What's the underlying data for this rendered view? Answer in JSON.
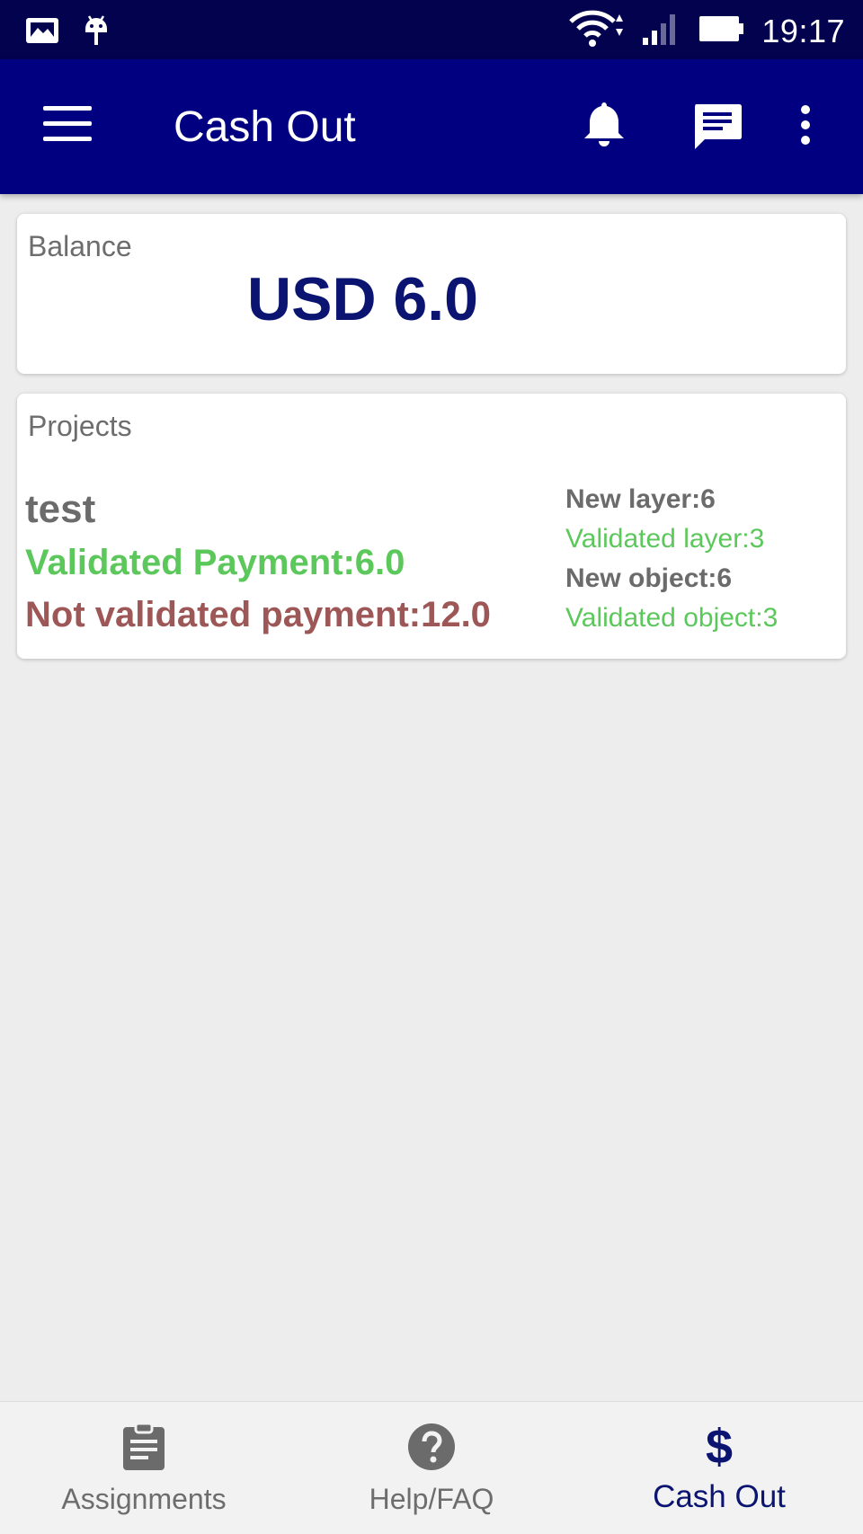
{
  "status_bar": {
    "time": "19:17",
    "icons": [
      "image-icon",
      "android-icon",
      "wifi-icon",
      "signal-icon",
      "battery-icon"
    ]
  },
  "app_bar": {
    "title": "Cash Out",
    "icons": [
      "menu-icon",
      "bell-icon",
      "chat-icon",
      "more-vert-icon"
    ],
    "background": "#000080"
  },
  "balance": {
    "label": "Balance",
    "value": "USD 6.0"
  },
  "projects": {
    "label": "Projects",
    "items": [
      {
        "name": "test",
        "validated_payment": "Validated Payment:6.0",
        "not_validated_payment": "Not validated payment:12.0",
        "new_layer": "New layer:6",
        "validated_layer": "Validated layer:3",
        "new_object": "New object:6",
        "validated_object": "Validated object:3"
      }
    ]
  },
  "bottom_nav": {
    "items": [
      {
        "label": "Assignments",
        "icon": "clipboard-icon",
        "active": false
      },
      {
        "label": "Help/FAQ",
        "icon": "help-icon",
        "active": false
      },
      {
        "label": "Cash Out",
        "icon": "dollar-icon",
        "active": true
      }
    ]
  },
  "colors": {
    "primary": "#000080",
    "balance_text": "#0b1471",
    "validated": "#5cc85c",
    "not_validated": "#9d5757"
  }
}
